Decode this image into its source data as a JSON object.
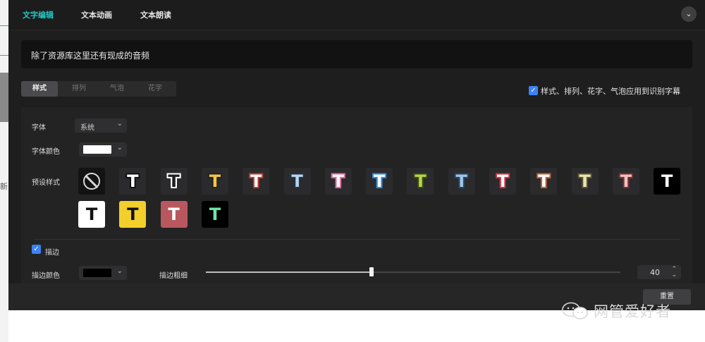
{
  "tabs": [
    {
      "label": "文字编辑",
      "active": true
    },
    {
      "label": "文本动画",
      "active": false
    },
    {
      "label": "文本朗读",
      "active": false
    }
  ],
  "text_content": "除了资源库这里还有现成的音频",
  "subtabs": [
    {
      "label": "样式",
      "active": true
    },
    {
      "label": "排列",
      "active": false
    },
    {
      "label": "气泡",
      "active": false
    },
    {
      "label": "花字",
      "active": false
    }
  ],
  "apply_checkbox": {
    "checked": true,
    "label": "样式、排列、花字、气泡应用到识别字幕"
  },
  "font": {
    "label": "字体",
    "value": "系统"
  },
  "font_color": {
    "label": "字体颜色",
    "color": "#ffffff"
  },
  "preset": {
    "label": "预设样式",
    "glyph": "T",
    "styles": [
      {
        "bg": "#131314",
        "none": true
      },
      {
        "bg": "#2b2b2d",
        "fill": "#ffffff",
        "stroke": "#111111"
      },
      {
        "bg": "#2b2b2d",
        "fill": "#1e1e1f",
        "stroke": "#ffffff"
      },
      {
        "bg": "#2b2b2d",
        "fill": "#f5c542",
        "stroke": "#222222"
      },
      {
        "bg": "#2b2b2d",
        "fill": "#ffffff",
        "stroke": "#c0392b"
      },
      {
        "bg": "#2b2b2d",
        "fill": "#bcd4f0",
        "stroke": "#223344"
      },
      {
        "bg": "#2b2b2d",
        "fill": "#ffffff",
        "stroke": "#e06aa0"
      },
      {
        "bg": "#2b2b2d",
        "fill": "#ffffff",
        "stroke": "#2a8fe0"
      },
      {
        "bg": "#2b2b2d",
        "fill": "#b8d44a",
        "stroke": "#3a4a10"
      },
      {
        "bg": "#2b2b2d",
        "fill": "#9fc4e8",
        "stroke": "#2a4460"
      },
      {
        "bg": "#2b2b2d",
        "fill": "#ffffff",
        "stroke": "#d03040"
      },
      {
        "bg": "#2b2b2d",
        "fill": "#ffffff",
        "stroke": "#c0603a"
      },
      {
        "bg": "#2b2b2d",
        "fill": "#e8e4b0",
        "stroke": "#5a5230"
      },
      {
        "bg": "#2b2b2d",
        "fill": "#f0c0c0",
        "stroke": "#7a3030"
      },
      {
        "bg": "#000000",
        "fill": "#ffffff",
        "stroke": "#000000"
      },
      {
        "bg": "#ffffff",
        "fill": "#111111",
        "stroke": "#ffffff"
      },
      {
        "bg": "#f3cf2b",
        "fill": "#111111",
        "stroke": "#f3cf2b"
      },
      {
        "bg": "#b9575f",
        "fill": "#ffffff",
        "stroke": "#b9575f"
      },
      {
        "bg": "#000000",
        "fill": "#6ee7a8",
        "stroke": "#000000"
      }
    ]
  },
  "stroke": {
    "checkbox_label": "描边",
    "checked": true,
    "color_label": "描边颜色",
    "color": "#000000",
    "width_label": "描边粗细",
    "width_value": "40",
    "slider_fraction": 0.4
  },
  "footer": {
    "reset_label": "重置"
  },
  "watermark": {
    "text": "网管爱好者",
    "icon": "wechat-icon"
  },
  "left_strip": {
    "char": "新"
  }
}
